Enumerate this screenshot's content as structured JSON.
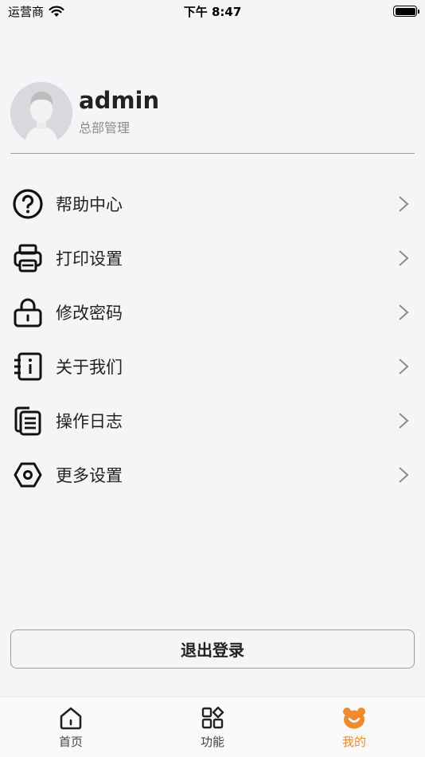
{
  "status_bar": {
    "carrier": "运营商",
    "time": "下午 8:47"
  },
  "profile": {
    "username": "admin",
    "department": "总部管理"
  },
  "menu": {
    "items": [
      {
        "label": "帮助中心",
        "icon": "help-icon"
      },
      {
        "label": "打印设置",
        "icon": "printer-icon"
      },
      {
        "label": "修改密码",
        "icon": "lock-icon"
      },
      {
        "label": "关于我们",
        "icon": "info-icon"
      },
      {
        "label": "操作日志",
        "icon": "log-icon"
      },
      {
        "label": "更多设置",
        "icon": "settings-icon"
      }
    ]
  },
  "logout": {
    "label": "退出登录"
  },
  "tab_bar": {
    "tabs": [
      {
        "label": "首页",
        "icon": "home-icon",
        "active": false
      },
      {
        "label": "功能",
        "icon": "grid-icon",
        "active": false
      },
      {
        "label": "我的",
        "icon": "bear-icon",
        "active": true
      }
    ],
    "active_color": "#f08a2c"
  }
}
